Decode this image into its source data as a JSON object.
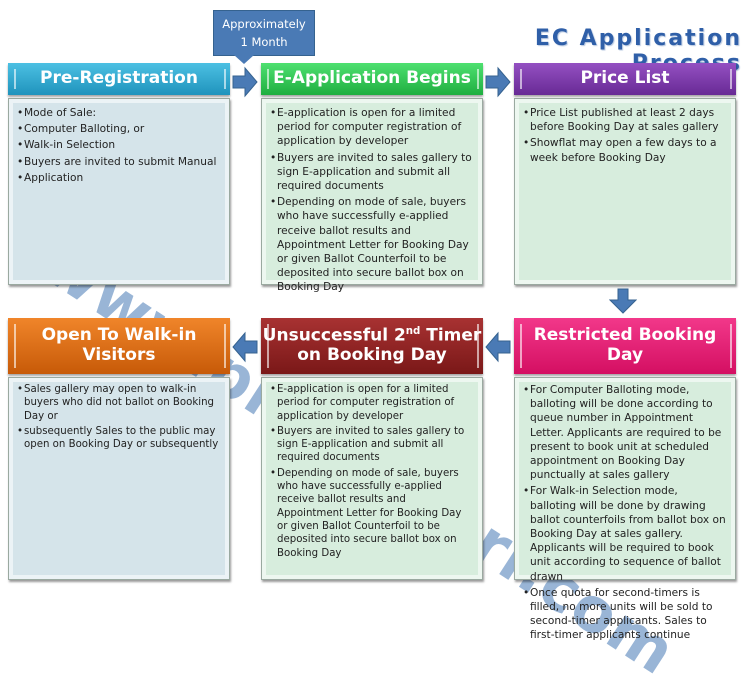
{
  "title": "EC Application Process",
  "callout": {
    "line1": "Approximately",
    "line2": "1 Month"
  },
  "watermark": "www.propsafari.com",
  "colors": {
    "pre_registration": "#2fa9cf",
    "e_application": "#2bc54f",
    "price_list": "#7a35a8",
    "restricted_booking": "#e5146f",
    "unsuccessful": "#8e1f1f",
    "open_walkin": "#db6a0f",
    "arrow": "#4a7ab5",
    "title": "#2f5fa8"
  },
  "steps": [
    {
      "id": "pre-registration",
      "title": "Pre-Registration",
      "bullets": [
        "Mode of Sale:",
        " Computer Balloting, or",
        " Walk-in Selection",
        "Buyers are invited to submit Manual",
        "Application"
      ]
    },
    {
      "id": "e-application",
      "title": "E-Application Begins",
      "bullets": [
        "E-application is open for a limited period for computer registration of application by developer",
        "Buyers are invited to sales gallery to sign E-application and submit all required documents",
        "Depending on mode of sale, buyers who have successfully e-applied receive ballot results and Appointment Letter for Booking Day or given Ballot Counterfoil to be deposited into secure ballot box on Booking Day"
      ]
    },
    {
      "id": "price-list",
      "title": "Price List",
      "bullets": [
        "Price List published at least 2 days before Booking Day at sales gallery",
        "Showflat may open a few days to a week before Booking Day"
      ]
    },
    {
      "id": "restricted-booking",
      "title": "Restricted Booking Day",
      "bullets": [
        "For Computer Balloting mode, balloting will be done according to queue number in Appointment Letter. Applicants are required to be present to book unit at scheduled appointment on Booking Day punctually at sales gallery",
        "For Walk-in Selection mode, balloting will be done by drawing ballot counterfoils from ballot box on Booking Day at sales gallery. Applicants will be required to book unit according to sequence of ballot drawn",
        "Once quota for second-timers is filled, no more units will be sold to second-timer applicants. Sales to first-timer applicants continue"
      ]
    },
    {
      "id": "unsuccessful",
      "title_a": "Unsuccessful 2",
      "title_sup": "nd",
      "title_b": " Timer",
      "title_c": "on Booking Day",
      "bullets": [
        "E-application is open for a limited period for computer registration of application by developer",
        "Buyers are invited to sales gallery to sign E-application and submit all required documents",
        "Depending on mode of sale, buyers who have successfully e-applied receive ballot results and Appointment Letter for Booking Day or given Ballot Counterfoil to be deposited into secure ballot box on Booking Day"
      ]
    },
    {
      "id": "open-walkin",
      "title_a": "Open To Walk-in",
      "title_c": "Visitors",
      "bullets": [
        "Sales gallery may open to walk-in buyers who did not ballot on Booking Day or",
        "subsequently Sales to the public may open on Booking Day or subsequently"
      ]
    }
  ]
}
